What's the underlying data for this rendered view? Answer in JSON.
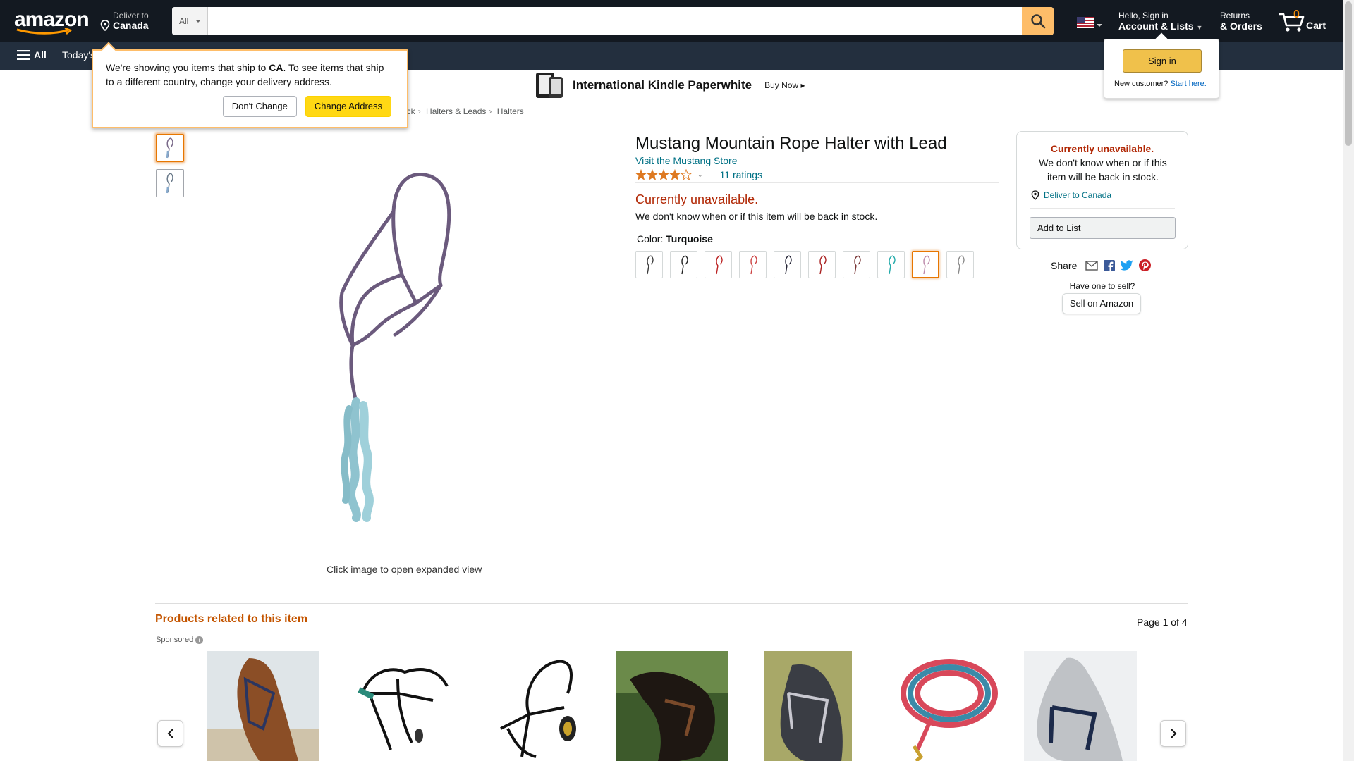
{
  "header": {
    "logo_text": "amazon",
    "deliver_line1": "Deliver to",
    "deliver_line2": "Canada",
    "search_category": "All",
    "search_placeholder": "",
    "account_line1": "Hello, Sign in",
    "account_line2": "Account & Lists",
    "returns_line1": "Returns",
    "returns_line2": "& Orders",
    "cart_count": "0",
    "cart_label": "Cart"
  },
  "subnav": {
    "all_label": "All",
    "link_todays": "Today's"
  },
  "popover": {
    "text_before": "We're showing you items that ship to ",
    "country": "CA",
    "text_after": ". To see items that ship to a different country, change your delivery address.",
    "dont_change": "Don't Change",
    "change_address": "Change Address"
  },
  "signin_dropdown": {
    "button": "Sign in",
    "new_customer": "New customer?",
    "start_here": "Start here."
  },
  "banner": {
    "title": "International Kindle Paperwhite",
    "buy_now": "Buy Now ▸"
  },
  "breadcrumb": [
    "ack",
    "Halters & Leads",
    "Halters"
  ],
  "product": {
    "title": "Mustang Mountain Rope Halter with Lead",
    "store_link": "Visit the Mustang Store",
    "rating_stars": 4,
    "ratings_count": "11 ratings",
    "unavailable": "Currently unavailable.",
    "unavailable_sub": "We don't know when or if this item will be back in stock.",
    "color_label": "Color:",
    "color_value": "Turquoise",
    "swatches": [
      "#3a3a3a",
      "#222",
      "#b22",
      "#c44",
      "#223",
      "#a22",
      "#733",
      "#2aa",
      "#b8a",
      "#888"
    ],
    "selected_swatch": 8,
    "click_note": "Click image to open expanded view"
  },
  "buybox": {
    "unavailable": "Currently unavailable.",
    "sub": "We don't know when or if this item will be back in stock.",
    "deliver": "Deliver to Canada",
    "add_to_list": "Add to List"
  },
  "share": {
    "label": "Share",
    "have_one": "Have one to sell?",
    "sell_button": "Sell on Amazon"
  },
  "related": {
    "title": "Products related to this item",
    "page": "Page 1 of 4",
    "sponsored": "Sponsored"
  },
  "colors": {
    "nav_dark": "#131921",
    "nav_sub": "#232f3e",
    "accent": "#febd69",
    "link": "#007185",
    "unavailable": "#b12704",
    "related_title": "#c45500"
  }
}
